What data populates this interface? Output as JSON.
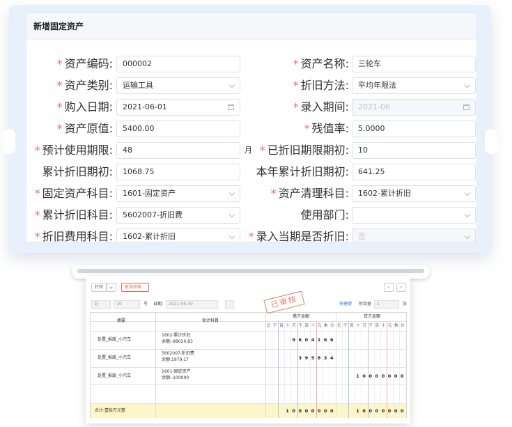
{
  "form": {
    "title": "新增固定资产",
    "required_mark": "*",
    "fields": {
      "asset_code": {
        "label": "资产编码:",
        "value": "000002"
      },
      "asset_name": {
        "label": "资产名称:",
        "value": "三轮车"
      },
      "asset_category": {
        "label": "资产类别:",
        "value": "运输工具"
      },
      "depreciation_method": {
        "label": "折旧方法:",
        "value": "平均年限法"
      },
      "purchase_date": {
        "label": "购入日期:",
        "value": "2021-06-01"
      },
      "entry_period": {
        "label": "录入期间:",
        "value": "2021-06"
      },
      "original_value": {
        "label": "资产原值:",
        "value": "5400.00"
      },
      "residual_rate": {
        "label": "残值率:",
        "value": "5.0000",
        "suffix": "%"
      },
      "expected_life": {
        "label": "预计使用期限:",
        "value": "48",
        "suffix": "月"
      },
      "depreciated_periods": {
        "label": "已折旧期限期初:",
        "value": "10",
        "suffix": "月"
      },
      "accum_depr_opening": {
        "label": "累计折旧期初:",
        "value": "1068.75"
      },
      "year_accum_depr_opening": {
        "label": "本年累计折旧期初:",
        "value": "641.25"
      },
      "fixed_asset_account": {
        "label": "固定资产科目:",
        "value": "1601-固定资产"
      },
      "asset_clearing_account": {
        "label": "资产清理科目:",
        "value": "1602-累计折旧"
      },
      "accum_depr_account": {
        "label": "累计折旧科目:",
        "value": "5602007-折旧费"
      },
      "department": {
        "label": "使用部门:",
        "value": ""
      },
      "depr_expense_account": {
        "label": "折旧费用科目:",
        "value": "1602-累计折旧"
      },
      "depr_current_period": {
        "label": "录入当期是否折旧:",
        "value": "否"
      }
    }
  },
  "voucher": {
    "print_label": "打印",
    "cancel_audit_label": "取消审核",
    "voucher_word": "记",
    "voucher_no": "10",
    "no_label": "号",
    "date_label": "日期:",
    "date_value": "2021-06-30",
    "shortcut_label": "快捷键",
    "attach_label": "附单据",
    "attach_value": "1",
    "attach_unit": "张",
    "stamp": "已审核",
    "col_summary": "摘要",
    "col_account": "会计科目",
    "col_debit": "借方金额",
    "col_credit": "贷方金额",
    "units": [
      "亿",
      "千",
      "百",
      "十",
      "万",
      "千",
      "百",
      "十",
      "元",
      "角",
      "分"
    ],
    "rows": [
      {
        "summary": "处置_报废_小汽车",
        "account": "1602-累计折旧",
        "balance": "余额:-98020.83",
        "debit": "9604166",
        "credit": ""
      },
      {
        "summary": "处置_报废_小汽车",
        "account": "5602007-折旧费",
        "balance": "余额:1979.17",
        "debit": "395834",
        "credit": ""
      },
      {
        "summary": "处置_报废_小汽车",
        "account": "1601-固定资产",
        "balance": "余额:-100000",
        "debit": "",
        "credit": "10000000"
      }
    ],
    "total_label": "合计:壹拾万元整",
    "total_debit": "10000000",
    "total_credit": "10000000"
  }
}
